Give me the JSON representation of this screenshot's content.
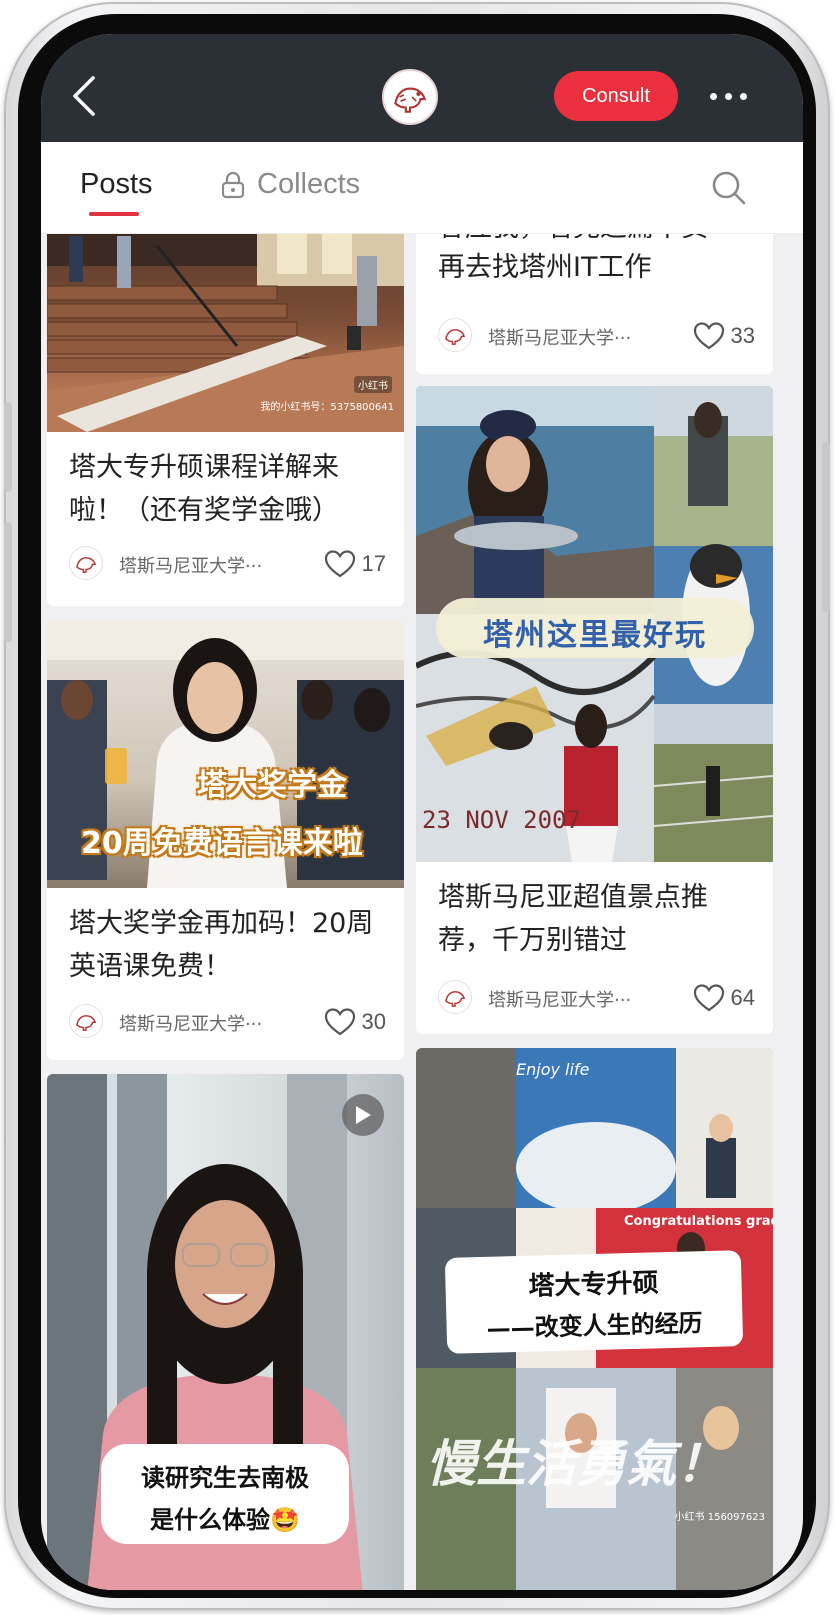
{
  "header": {
    "consult_label": "Consult"
  },
  "tabs": {
    "posts": "Posts",
    "collects": "Collects"
  },
  "posts": [
    {
      "title": "塔大专升硕课程详解来啦！（还有奖学金哦）",
      "author": "塔斯马尼亚大学···",
      "likes": "17",
      "watermark_brand": "小红书",
      "watermark_id": "我的小红书号：5375800641"
    },
    {
      "title": "塔大奖学金再加码！20周英语课免费！",
      "overlay_line1": "塔大奖学金",
      "overlay_line2": "20周免费语言课来啦",
      "author": "塔斯马尼亚大学···",
      "likes": "30"
    },
    {
      "overlay_line1": "读研究生去南极",
      "overlay_line2": "是什么体验🤩"
    },
    {
      "title": "再去找塔州IT工作",
      "title_top_partial": "答应我，看完这篇干货",
      "author": "塔斯马尼亚大学···",
      "likes": "33"
    },
    {
      "title": "塔斯马尼亚超值景点推荐，千万别错过",
      "overlay_banner": "塔州这里最好玩",
      "overlay_date": "23 NOV 2007",
      "author": "塔斯马尼亚大学···",
      "likes": "64"
    },
    {
      "overlay_enjoy": "Enjoy life",
      "overlay_congrats": "Congratulations gradu",
      "overlay_line1": "塔大专升硕",
      "overlay_line2": "——改变人生的经历",
      "overlay_bottom": "慢生活勇氣！",
      "watermark_id": "小红书 156097623"
    }
  ]
}
